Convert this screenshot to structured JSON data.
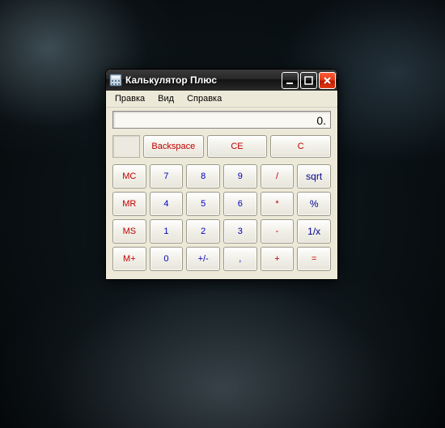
{
  "window": {
    "title": "Калькулятор Плюс"
  },
  "menu": {
    "edit": "Правка",
    "view": "Вид",
    "help": "Справка"
  },
  "display": {
    "value": "0."
  },
  "top": {
    "backspace": "Backspace",
    "ce": "CE",
    "c": "C"
  },
  "mem": {
    "mc": "MC",
    "mr": "MR",
    "ms": "MS",
    "mplus": "M+"
  },
  "num": {
    "n0": "0",
    "n1": "1",
    "n2": "2",
    "n3": "3",
    "n4": "4",
    "n5": "5",
    "n6": "6",
    "n7": "7",
    "n8": "8",
    "n9": "9",
    "dot": ",",
    "plusminus": "+/-"
  },
  "op": {
    "div": "/",
    "mul": "*",
    "sub": "-",
    "add": "+",
    "sqrt": "sqrt",
    "pct": "%",
    "inv": "1/x",
    "eq": "="
  }
}
